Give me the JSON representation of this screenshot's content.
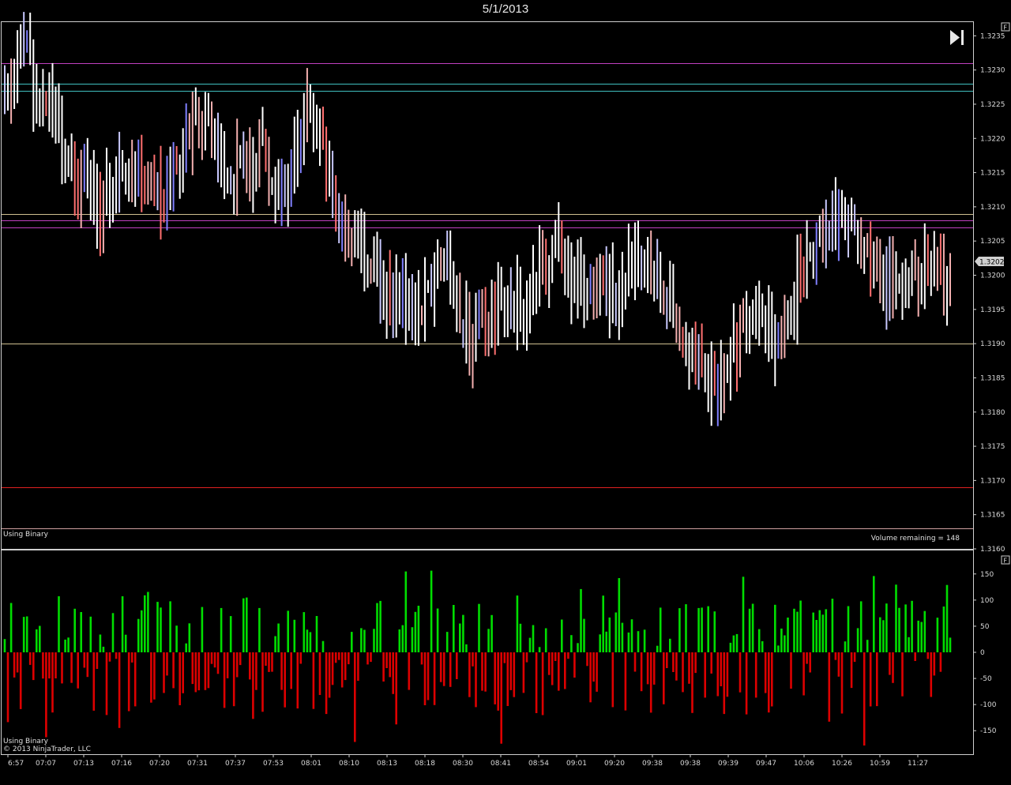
{
  "title": "5/1/2013",
  "price_panel": {
    "indicator_label": "Using Binary",
    "volume_remaining": "Volume remaining = 148",
    "last_price_label": "1.3202",
    "panel_flag": "F"
  },
  "volume_panel": {
    "indicator_label": "Using Binary",
    "copyright": "© 2013 NinjaTrader, LLC",
    "panel_flag": "F"
  },
  "colors": {
    "background": "#000000",
    "axis": "#cfcfcf",
    "bar_neutral": "#ffffff",
    "bar_up": "#8080ff",
    "bar_down": "#ff7070",
    "volume_positive": "#00dd00",
    "volume_negative": "#dd0000",
    "level_magenta": "#c040c0",
    "level_cyan": "#40c0c0",
    "level_tan": "#d0c090",
    "level_red": "#e02020"
  },
  "chart_data": [
    {
      "type": "ohlc",
      "ylim": [
        1.316,
        1.3237
      ],
      "yticks": [
        "1.3235",
        "1.3230",
        "1.3225",
        "1.3220",
        "1.3215",
        "1.3210",
        "1.3205",
        "1.3200",
        "1.3195",
        "1.3190",
        "1.3185",
        "1.3180",
        "1.3175",
        "1.3170",
        "1.3165",
        "1.3160"
      ],
      "x_tick_labels": [
        "6:57",
        "07:07",
        "07:13",
        "07:16",
        "07:20",
        "07:31",
        "07:37",
        "07:53",
        "08:01",
        "08:10",
        "08:13",
        "08:18",
        "08:30",
        "08:41",
        "08:54",
        "09:01",
        "09:20",
        "09:38",
        "09:38",
        "09:39",
        "09:47",
        "10:06",
        "10:26",
        "10:59",
        "11:27"
      ],
      "horizontal_levels": [
        {
          "price": 1.3231,
          "color": "#c040c0"
        },
        {
          "price": 1.3228,
          "color": "#40c0c0"
        },
        {
          "price": 1.3227,
          "color": "#40c0c0"
        },
        {
          "price": 1.3209,
          "color": "#d0c090"
        },
        {
          "price": 1.3208,
          "color": "#c040c0"
        },
        {
          "price": 1.3207,
          "color": "#c040c0"
        },
        {
          "price": 1.319,
          "color": "#d0c090"
        },
        {
          "price": 1.3169,
          "color": "#e02020"
        },
        {
          "price": 1.3163,
          "color": "#d0a0a0"
        }
      ],
      "close_anchors": [
        [
          0,
          1.3226
        ],
        [
          6,
          1.3232
        ],
        [
          12,
          1.3226
        ],
        [
          22,
          1.3214
        ],
        [
          30,
          1.321
        ],
        [
          40,
          1.3218
        ],
        [
          50,
          1.3211
        ],
        [
          62,
          1.3225
        ],
        [
          70,
          1.3215
        ],
        [
          80,
          1.3218
        ],
        [
          88,
          1.321
        ],
        [
          96,
          1.3226
        ],
        [
          104,
          1.321
        ],
        [
          110,
          1.3206
        ],
        [
          118,
          1.3198
        ],
        [
          130,
          1.3195
        ],
        [
          138,
          1.3203
        ],
        [
          146,
          1.3191
        ],
        [
          154,
          1.3195
        ],
        [
          162,
          1.3195
        ],
        [
          172,
          1.3204
        ],
        [
          182,
          1.3198
        ],
        [
          192,
          1.3197
        ],
        [
          200,
          1.3205
        ],
        [
          206,
          1.32
        ],
        [
          212,
          1.3193
        ],
        [
          218,
          1.3185
        ],
        [
          226,
          1.3185
        ],
        [
          234,
          1.3195
        ],
        [
          242,
          1.319
        ],
        [
          248,
          1.3198
        ],
        [
          256,
          1.3205
        ],
        [
          264,
          1.3208
        ],
        [
          270,
          1.3202
        ],
        [
          280,
          1.3197
        ],
        [
          290,
          1.3202
        ],
        [
          298,
          1.3198
        ]
      ],
      "bar_count": 298,
      "last_price": 1.3202
    },
    {
      "type": "bar",
      "name": "",
      "ylim": [
        -195,
        195
      ],
      "yticks": [
        150,
        100,
        50,
        0,
        -50,
        -100,
        -150
      ],
      "bar_count": 298
    }
  ]
}
